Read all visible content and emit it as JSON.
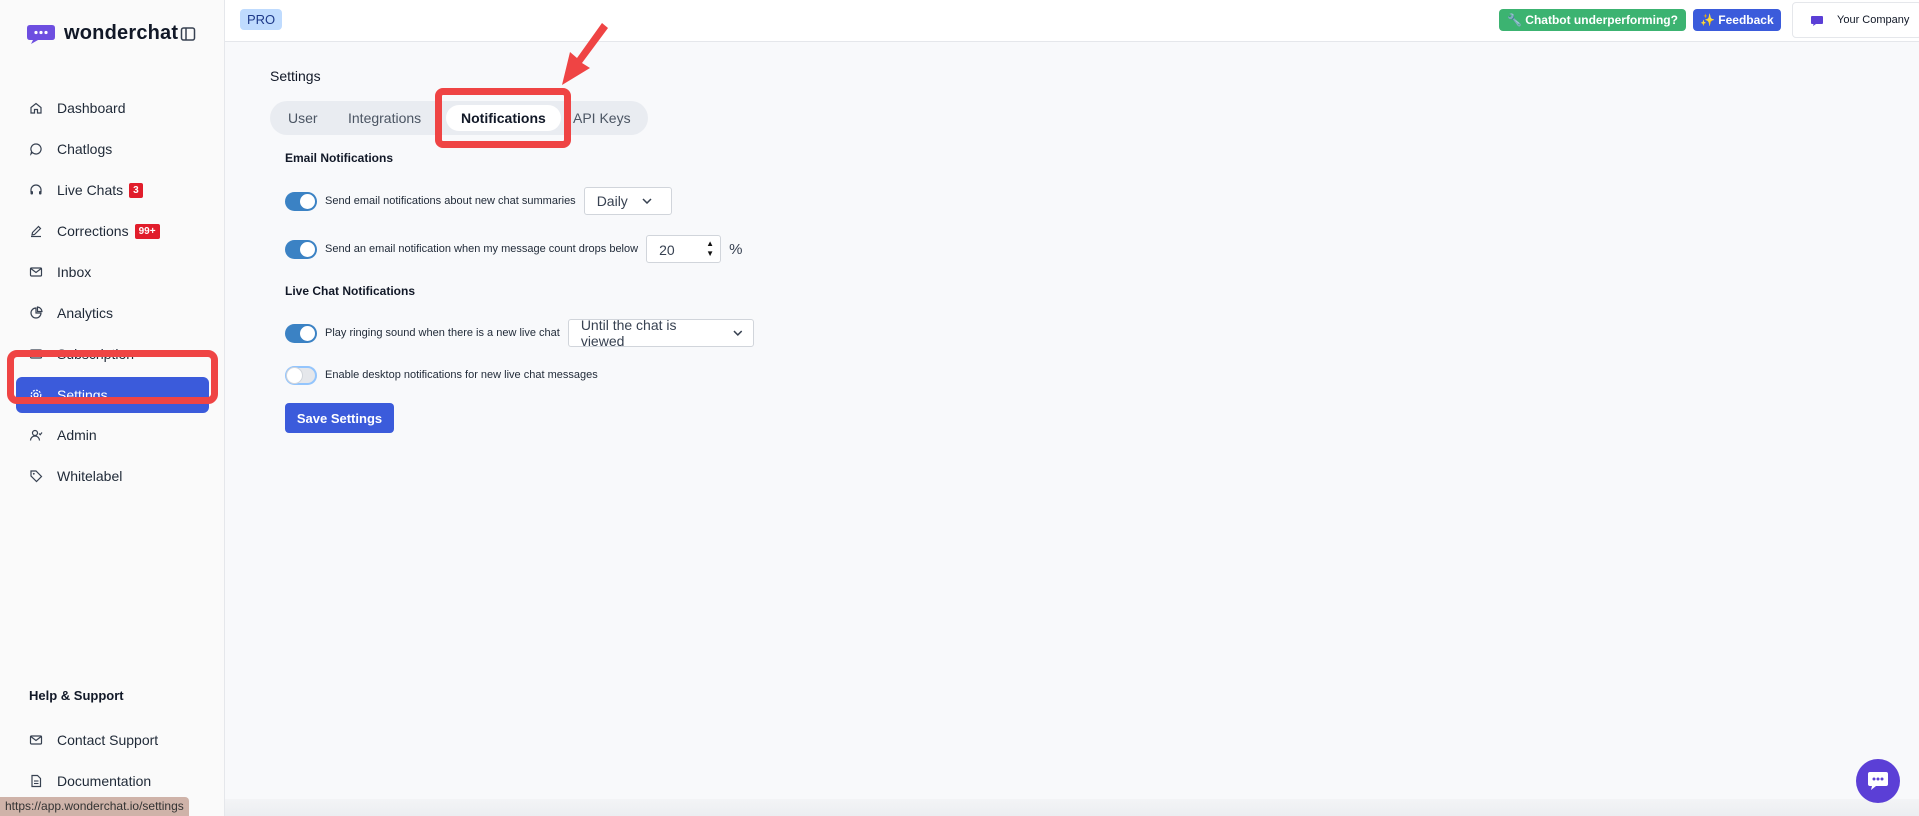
{
  "brand": {
    "name": "wonderchat",
    "accent": "#3b5bdb"
  },
  "sidebar": {
    "items": [
      {
        "label": "Dashboard",
        "icon": "home-icon"
      },
      {
        "label": "Chatlogs",
        "icon": "chat-bubble-icon"
      },
      {
        "label": "Live Chats",
        "icon": "headset-icon",
        "badge": "3"
      },
      {
        "label": "Corrections",
        "icon": "pencil-icon",
        "badge": "99+"
      },
      {
        "label": "Inbox",
        "icon": "mail-icon"
      },
      {
        "label": "Analytics",
        "icon": "pie-chart-icon"
      },
      {
        "label": "Subscription",
        "icon": "card-icon"
      },
      {
        "label": "Settings",
        "icon": "gear-icon",
        "active": true
      },
      {
        "label": "Admin",
        "icon": "user-icon"
      },
      {
        "label": "Whitelabel",
        "icon": "tag-icon"
      }
    ],
    "help_title": "Help & Support",
    "help_items": [
      {
        "label": "Contact Support",
        "icon": "mail-icon"
      },
      {
        "label": "Documentation",
        "icon": "document-icon"
      }
    ]
  },
  "topbar": {
    "plan": "PRO",
    "underperforming": "🔧 Chatbot underperforming?",
    "feedback": "✨ Feedback",
    "company": "Your Company"
  },
  "page": {
    "title": "Settings",
    "tabs": [
      "User",
      "Integrations",
      "Notifications",
      "API Keys"
    ],
    "active_tab": "Notifications"
  },
  "email_notifications": {
    "title": "Email Notifications",
    "summaries": {
      "label": "Send email notifications about new chat summaries",
      "enabled": true,
      "frequency": "Daily"
    },
    "message_count": {
      "label": "Send an email notification when my message count drops below",
      "enabled": true,
      "threshold": "20",
      "unit": "%"
    }
  },
  "live_chat_notifications": {
    "title": "Live Chat Notifications",
    "ringing": {
      "label": "Play ringing sound when there is a new live chat",
      "enabled": true,
      "mode": "Until the chat is viewed"
    },
    "desktop": {
      "label": "Enable desktop notifications for new live chat messages",
      "enabled": false
    }
  },
  "save_label": "Save Settings",
  "status_url": "https://app.wonderchat.io/settings"
}
